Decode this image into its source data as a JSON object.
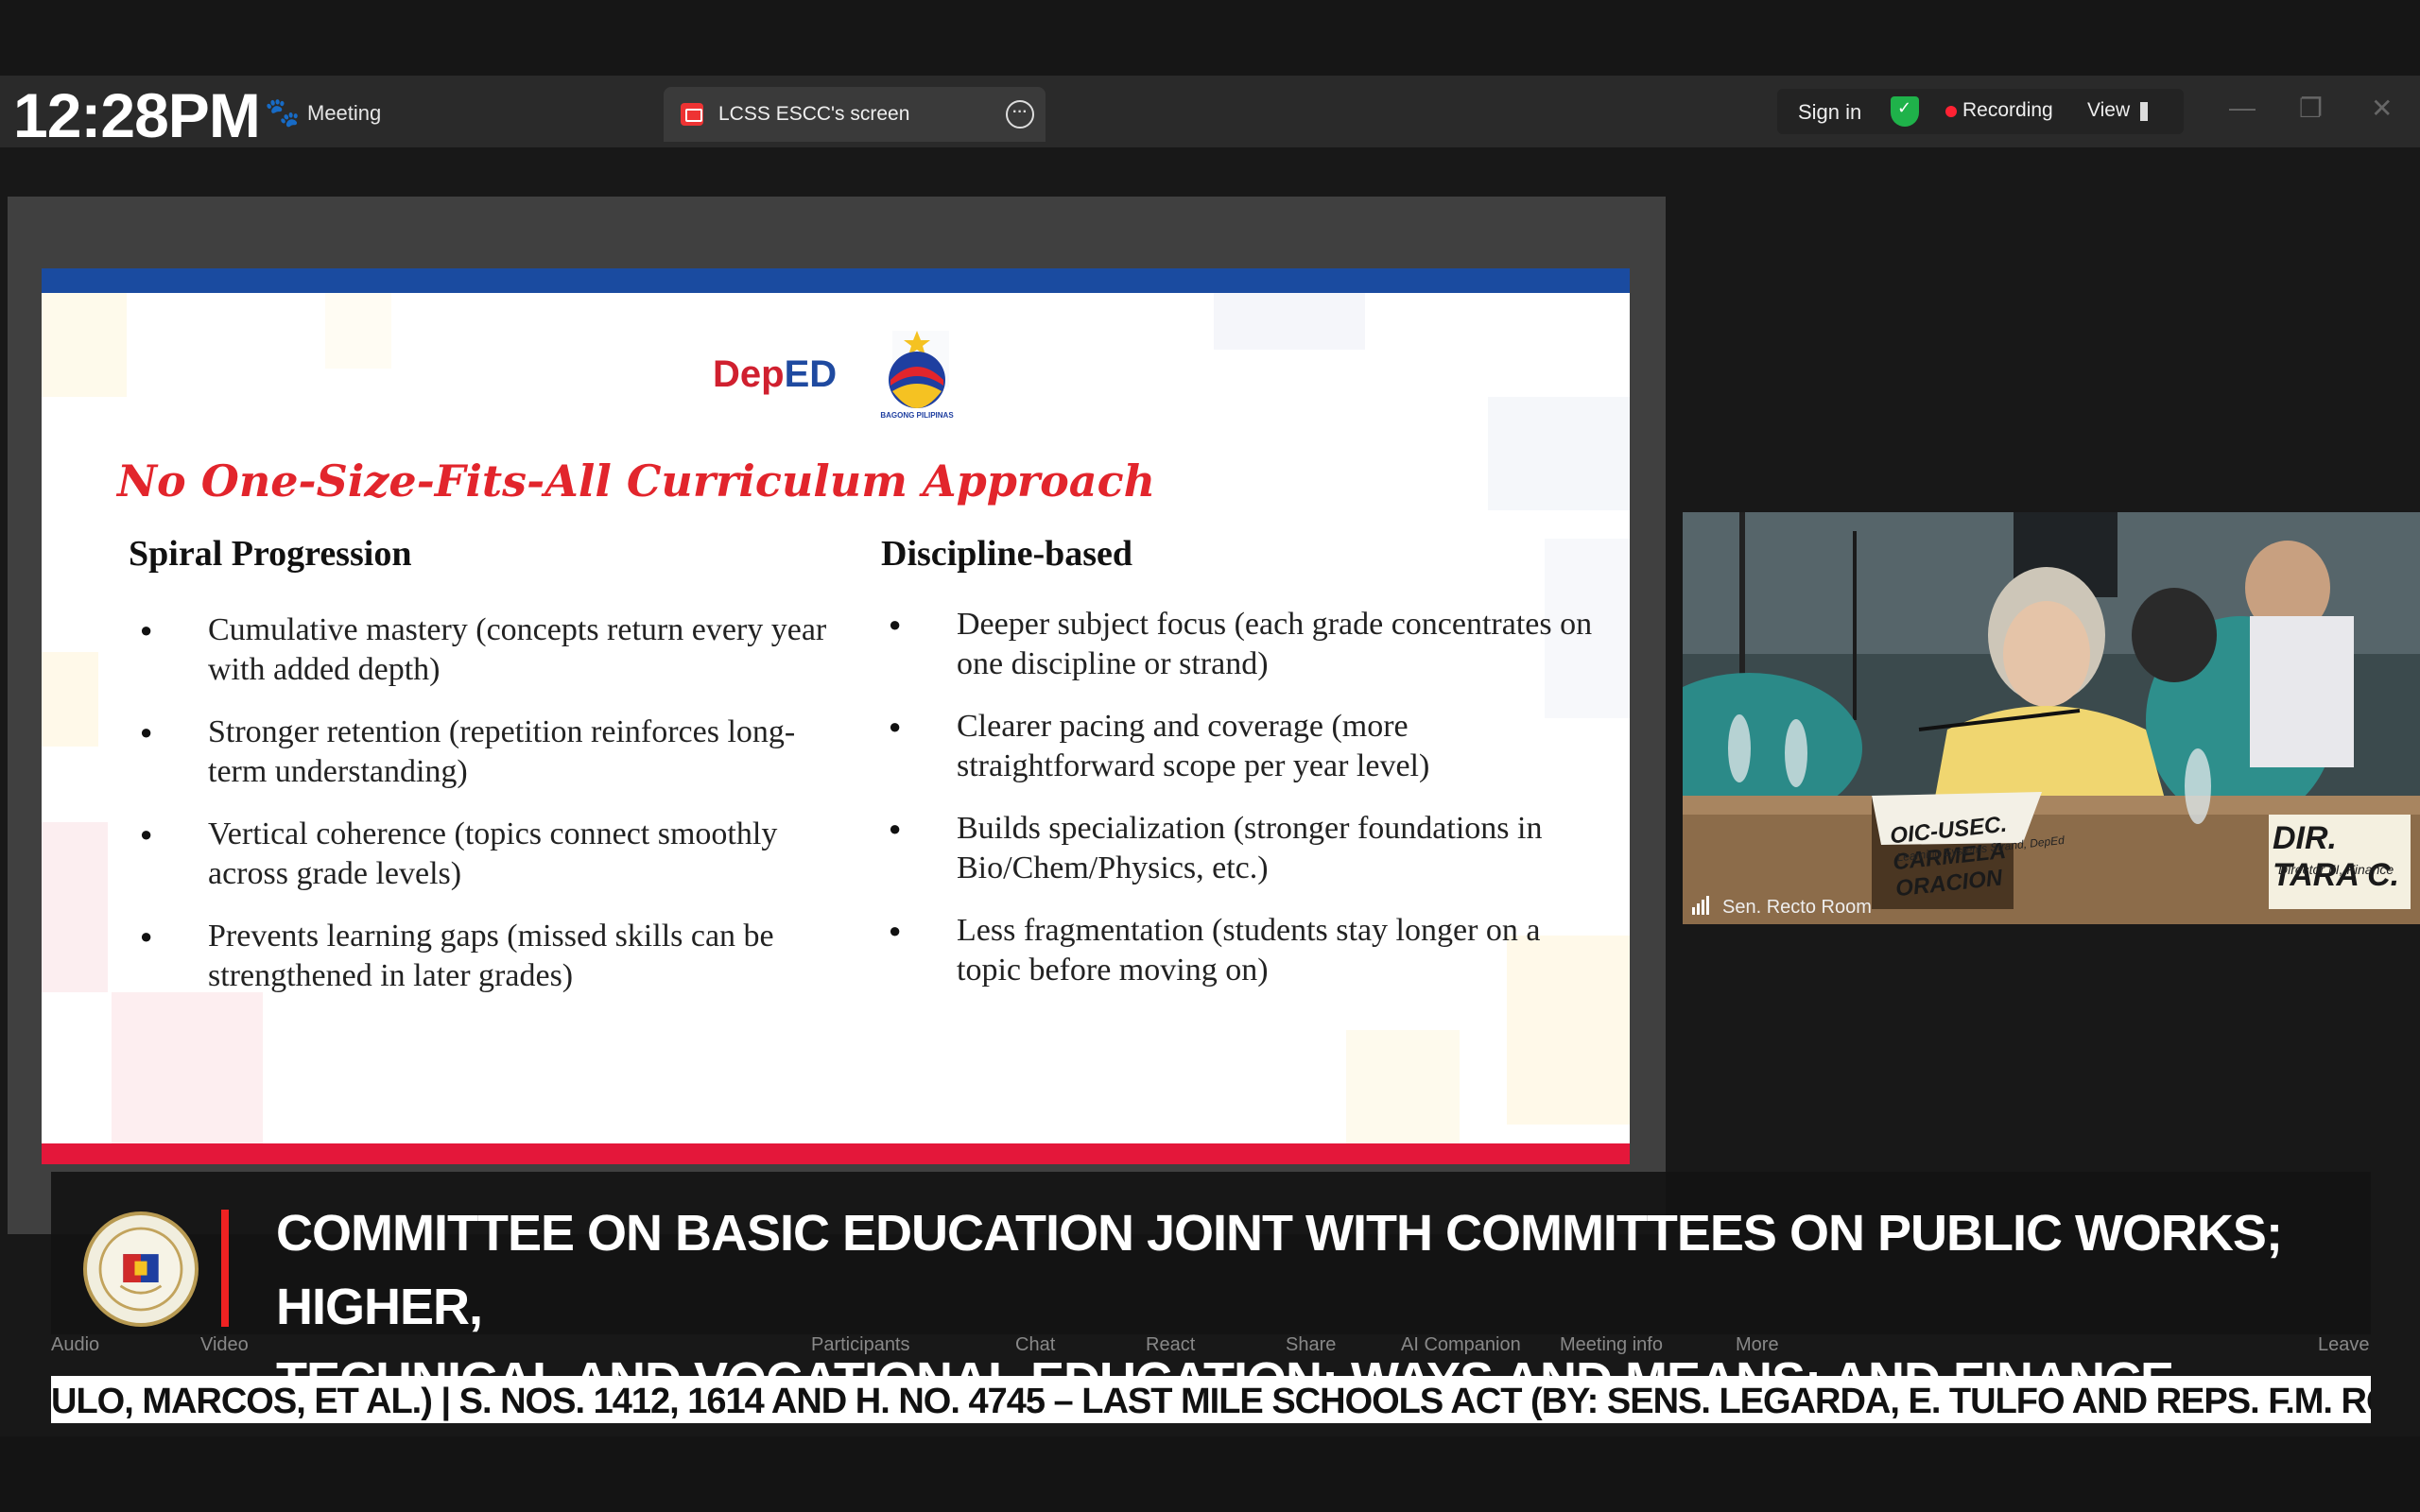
{
  "clock": "12:28PM",
  "app": {
    "meeting_label": "Meeting"
  },
  "share_tab": {
    "label": "LCSS ESCC's screen"
  },
  "toolbar": {
    "sign_in": "Sign in",
    "recording": "Recording",
    "view": "View"
  },
  "slide": {
    "logo_text_a": "Dep",
    "logo_text_b": "ED",
    "logo_sub": "BAGONG PILIPINAS",
    "title": "No One-Size-Fits-All Curriculum Approach",
    "left": {
      "heading": "Spiral Progression",
      "items": [
        "Cumulative mastery (concepts return every year with added depth)",
        "Stronger retention (repetition reinforces long-term understanding)",
        "Vertical coherence (topics connect smoothly across grade levels)",
        "Prevents learning gaps (missed skills can be strengthened in later grades)"
      ]
    },
    "right": {
      "heading": "Discipline-based",
      "items": [
        "Deeper subject focus (each grade concentrates on one discipline or strand)",
        "Clearer pacing and coverage (more straightforward scope per year level)",
        "Builds specialization (stronger foundations in Bio/Chem/Physics, etc.)",
        "Less fragmentation (students stay longer on a topic before moving on)"
      ]
    }
  },
  "video": {
    "room": "Sen. Recto Room",
    "nameplate_1": "OIC-USEC. CARMELA ORACION",
    "nameplate_1_sub": "Learning Systems Strand, DepEd",
    "nameplate_2": "DIR. TARA C.",
    "nameplate_2_sub": "Director III, Finance"
  },
  "lower_third": {
    "line1": "COMMITTEE ON BASIC EDUCATION JOINT WITH COMMITTEES ON PUBLIC WORKS; HIGHER,",
    "line2": "TECHNICAL AND VOCATIONAL EDUCATION; WAYS AND MEANS; AND FINANCE"
  },
  "zoom_bar": {
    "audio": "Audio",
    "video": "Video",
    "participants": "Participants",
    "chat": "Chat",
    "react": "React",
    "share": "Share",
    "ai": "AI Companion",
    "info": "Meeting info",
    "more": "More",
    "leave": "Leave"
  },
  "ticker": "ULO, MARCOS, ET AL.)  |  S. NOS. 1412, 1614 AND H. NO. 4745 – LAST MILE SCHOOLS ACT (BY: SENS. LEGARDA, E. TULFO AND REPS. F.M. ROMUALDEZ, ROM",
  "colors": {
    "slide_blue": "#1a4ba0",
    "slide_red": "#e4173a",
    "title_red": "#e2252c",
    "recording_red": "#ff2233",
    "shield_green": "#1fb24a"
  }
}
